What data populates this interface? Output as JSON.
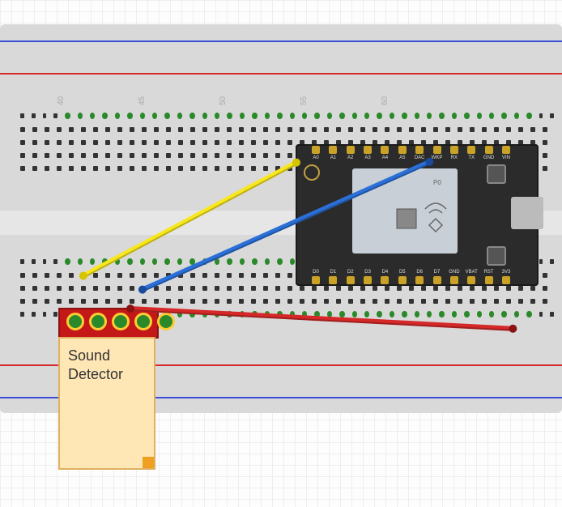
{
  "components": {
    "breadboard": {
      "column_labels": [
        "40",
        "45",
        "50",
        "55",
        "60"
      ]
    },
    "photon": {
      "top_pins": [
        "A0",
        "A1",
        "A2",
        "A3",
        "A4",
        "A5",
        "DAC",
        "WKP",
        "RX",
        "TX",
        "GND",
        "VIN"
      ],
      "bottom_pins": [
        "D0",
        "D1",
        "D2",
        "D3",
        "D4",
        "D5",
        "D6",
        "D7",
        "GND",
        "VBAT",
        "RST",
        "3V3"
      ],
      "module_label": "P0"
    },
    "sound_detector": {
      "line1": "Sound",
      "line2": "Detector",
      "pad_count": 5
    }
  },
  "wires": [
    {
      "name": "yellow",
      "from": "breadboard-col-41-bot-row-a",
      "to": "photon-A0-region",
      "color": "#f8e71c"
    },
    {
      "name": "blue",
      "from": "breadboard-col-44-bot-row-a",
      "to": "photon-D7-region",
      "color": "#2b6fd8"
    },
    {
      "name": "red",
      "from": "breadboard-col-43-bot-row-b",
      "to": "photon-3v3-region",
      "color": "#d62828"
    }
  ],
  "colors": {
    "breadboard": "#d9d9d9",
    "rail_blue": "#3a4fd8",
    "rail_red": "#d62828",
    "photon_body": "#2b2b2b",
    "sound_pcb": "#c41818",
    "sound_label_bg": "#ffe7b5"
  }
}
